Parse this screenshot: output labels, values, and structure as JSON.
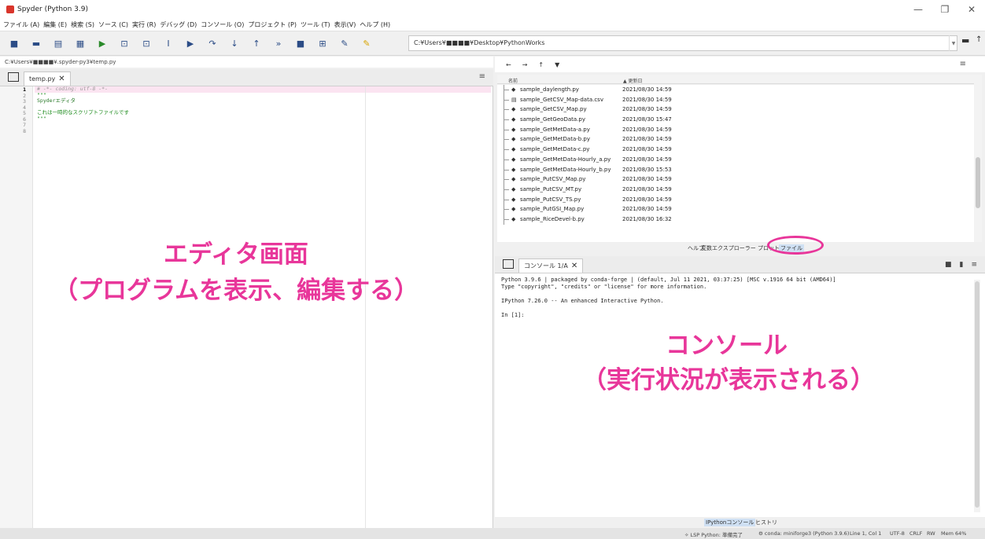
{
  "window": {
    "title": "Spyder (Python 3.9)",
    "controls": [
      "—",
      "❐",
      "✕"
    ]
  },
  "menubar": {
    "items": [
      "ファイル (A)",
      "編集 (E)",
      "検索 (S)",
      "ソース (C)",
      "実行 (R)",
      "デバッグ (D)",
      "コンソール (O)",
      "プロジェクト (P)",
      "ツール (T)",
      "表示(V)",
      "ヘルプ (H)"
    ]
  },
  "toolbar": {
    "path": "C:¥Users¥■■■■¥Desktop¥PythonWorks",
    "icons": {
      "new_file": "■",
      "open_file": "▬",
      "save": "▤",
      "save_all": "▦",
      "run": "▶",
      "run_cell": "⊡",
      "run_cell_advance": "⊡",
      "run_selection": "I",
      "debug": "▶",
      "step": "↷",
      "step_into": "↓",
      "step_return": "↑",
      "continue": "»",
      "stop": "■",
      "maximize": "⊞",
      "preferences": "✎",
      "python_path": "✎",
      "browse": "▬",
      "parent": "↑"
    }
  },
  "editor": {
    "path": "C:¥Users¥■■■■¥.spyder-py3¥temp.py",
    "tab_label": "temp.py",
    "tab_close": "✕",
    "menu_icon": "≡",
    "line_numbers": [
      "1",
      "2",
      "3",
      "4",
      "5",
      "6",
      "7",
      "8"
    ],
    "lines": [
      "# -*- coding: utf-8 -*-",
      "\"\"\"",
      "Spyderエディタ",
      "",
      "これは一時的なスクリプトファイルです",
      "\"\"\"",
      "",
      ""
    ]
  },
  "file_explorer": {
    "nav": [
      "←",
      "→",
      "↑",
      "▼"
    ],
    "menu_icon": "≡",
    "col_name": "名前",
    "col_date": "▲ 更新日",
    "files": [
      {
        "name": "sample_daylength.py",
        "date": "2021/08/30 14:59",
        "icon": "◆"
      },
      {
        "name": "sample_GetCSV_Map-data.csv",
        "date": "2021/08/30 14:59",
        "icon": "▤"
      },
      {
        "name": "sample_GetCSV_Map.py",
        "date": "2021/08/30 14:59",
        "icon": "◆"
      },
      {
        "name": "sample_GetGeoData.py",
        "date": "2021/08/30 15:47",
        "icon": "◆"
      },
      {
        "name": "sample_GetMetData-a.py",
        "date": "2021/08/30 14:59",
        "icon": "◆"
      },
      {
        "name": "sample_GetMetData-b.py",
        "date": "2021/08/30 14:59",
        "icon": "◆"
      },
      {
        "name": "sample_GetMetData-c.py",
        "date": "2021/08/30 14:59",
        "icon": "◆"
      },
      {
        "name": "sample_GetMetData-Hourly_a.py",
        "date": "2021/08/30 14:59",
        "icon": "◆"
      },
      {
        "name": "sample_GetMetData-Hourly_b.py",
        "date": "2021/08/30 15:53",
        "icon": "◆"
      },
      {
        "name": "sample_PutCSV_Map.py",
        "date": "2021/08/30 14:59",
        "icon": "◆"
      },
      {
        "name": "sample_PutCSV_MT.py",
        "date": "2021/08/30 14:59",
        "icon": "◆"
      },
      {
        "name": "sample_PutCSV_TS.py",
        "date": "2021/08/30 14:59",
        "icon": "◆"
      },
      {
        "name": "sample_PutGSI_Map.py",
        "date": "2021/08/30 14:59",
        "icon": "◆"
      },
      {
        "name": "sample_RiceDevel-b.py",
        "date": "2021/08/30 16:32",
        "icon": "◆"
      }
    ],
    "tabs": [
      "ヘルプ",
      "変数エクスプローラー",
      "プロット",
      "ファイル"
    ]
  },
  "console": {
    "tab_label": "コンソール 1/A",
    "tab_close": "✕",
    "tools": [
      "■",
      "▮",
      "≡"
    ],
    "lines": [
      "Python 3.9.6 | packaged by conda-forge | (default, Jul 11 2021, 03:37:25) [MSC v.1916 64 bit (AMD64)]",
      "Type \"copyright\", \"credits\" or \"license\" for more information.",
      "",
      "IPython 7.26.0 -- An enhanced Interactive Python.",
      "",
      "In [1]:"
    ],
    "tabs": [
      "IPythonコンソール",
      "ヒストリ"
    ]
  },
  "statusbar": {
    "lsp": "✧ LSP Python: 準備完了",
    "conda": "⚙ conda: miniforge3 (Python 3.9.6)",
    "position": "Line 1, Col 1",
    "encoding": "UTF-8",
    "eol": "CRLF",
    "rw": "RW",
    "mem": "Mem 64%"
  },
  "annotations": {
    "editor_title": "エディタ画面",
    "editor_desc": "（プログラムを表示、編集する）",
    "console_title": "コンソール",
    "console_desc": "（実行状況が表示される）"
  },
  "colors": {
    "annotation": "#e8369a",
    "current_line": "#fbe4f1",
    "code_green": "#1a8a1a"
  }
}
